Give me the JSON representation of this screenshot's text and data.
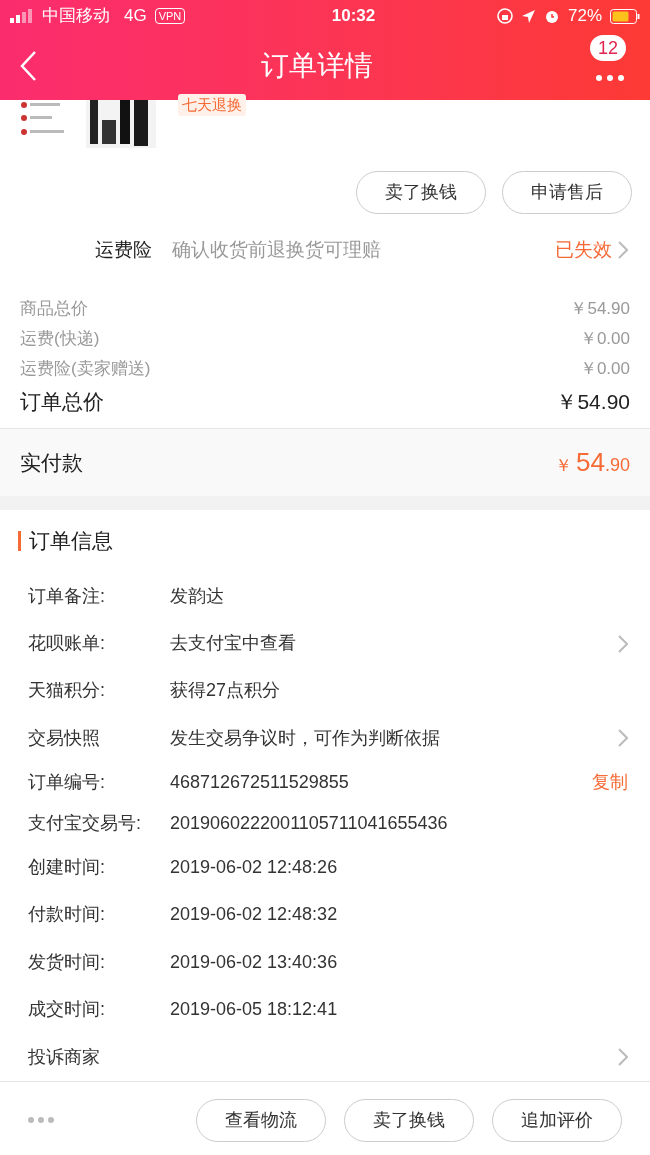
{
  "status_bar": {
    "carrier": "中国移动",
    "network": "4G",
    "vpn": "VPN",
    "time": "10:32",
    "battery": "72%"
  },
  "nav": {
    "title": "订单详情",
    "badge": "12"
  },
  "product": {
    "kind": "picture",
    "tag": "七天退换"
  },
  "actions": [
    "卖了换钱",
    "申请售后"
  ],
  "insurance": {
    "label": "运费险",
    "description": "确认收货前退换货可理赔",
    "status": "已失效"
  },
  "price_rows": [
    {
      "label": "商品总价",
      "value": "￥54.90"
    },
    {
      "label": "运费(快递)",
      "value": "￥0.00"
    },
    {
      "label": "运费险(卖家赠送)",
      "value": "￥0.00"
    }
  ],
  "order_total": {
    "label": "订单总价",
    "value": "￥54.90"
  },
  "paid": {
    "label": "实付款",
    "currency": "￥",
    "integer": "54",
    "decimal": ".90"
  },
  "order_info": {
    "title": "订单信息",
    "rows": [
      {
        "kind": "plain",
        "label": "订单备注:",
        "value": "发韵达"
      },
      {
        "kind": "link",
        "label": "花呗账单:",
        "value": "去支付宝中查看"
      },
      {
        "kind": "plain",
        "label": "天猫积分:",
        "value": "获得27点积分"
      },
      {
        "kind": "link",
        "label": "交易快照",
        "value": "发生交易争议时，可作为判断依据"
      },
      {
        "kind": "copy",
        "label": "订单编号:",
        "value": "468712672511529855",
        "action": "复制"
      },
      {
        "kind": "plain",
        "label": "支付宝交易号:",
        "value": "2019060222001105711041655436"
      },
      {
        "kind": "plain",
        "label": "创建时间:",
        "value": "2019-06-02 12:48:26"
      },
      {
        "kind": "plain",
        "label": "付款时间:",
        "value": "2019-06-02 12:48:32"
      },
      {
        "kind": "plain",
        "label": "发货时间:",
        "value": "2019-06-02 13:40:36"
      },
      {
        "kind": "plain",
        "label": "成交时间:",
        "value": "2019-06-05 18:12:41"
      },
      {
        "kind": "link",
        "label": "投诉商家"
      }
    ]
  },
  "bottom_buttons": [
    "查看物流",
    "卖了换钱",
    "追加评价"
  ]
}
